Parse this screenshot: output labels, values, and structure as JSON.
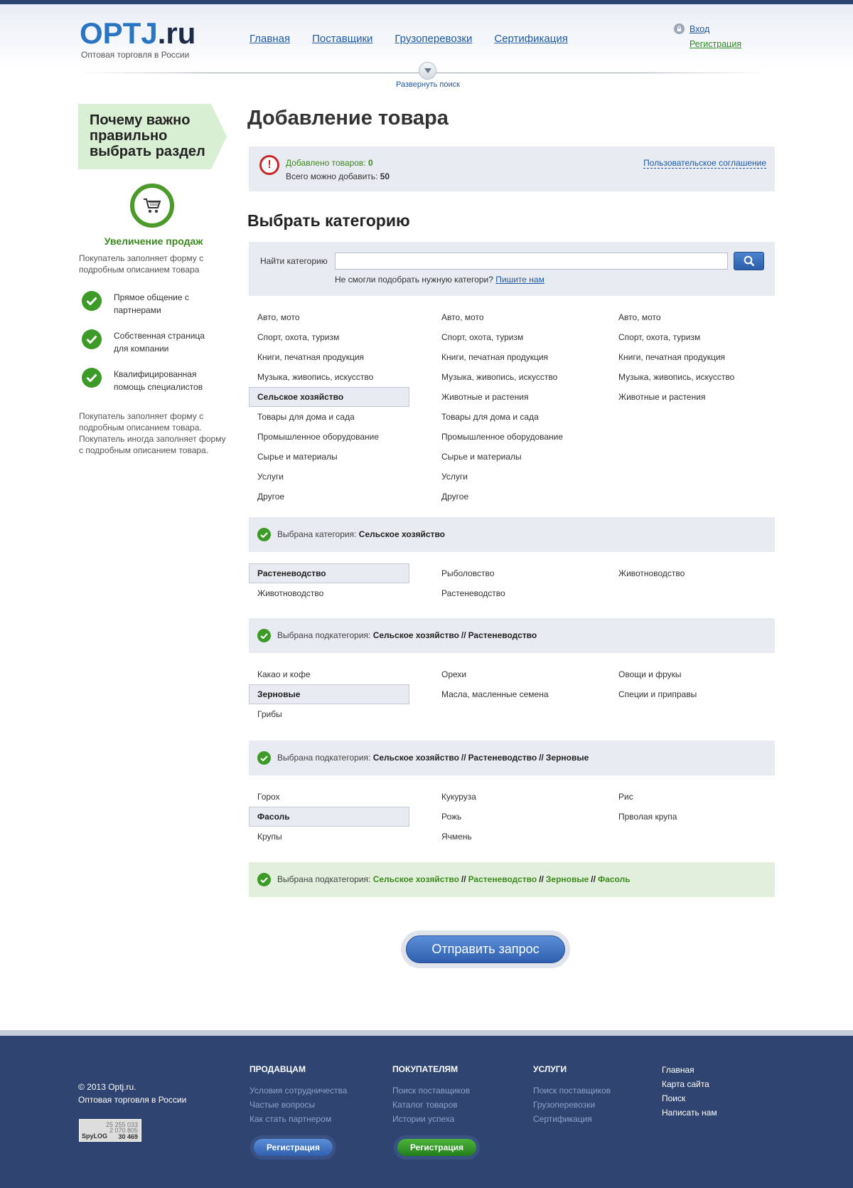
{
  "header": {
    "logo_main": "OPTJ",
    "logo_tld": ".ru",
    "logo_sub": "Оптовая торговля в России",
    "nav": [
      "Главная",
      "Поставщики",
      "Грузоперевозки",
      "Сертификация"
    ],
    "login": "Вход",
    "register": "Регистрация",
    "expand_search": "Развернуть поиск"
  },
  "sidebar": {
    "why_title": "Почему важно правильно выбрать раздел",
    "sales_title": "Увеличение продаж",
    "sales_desc": "Покупатель заполняет форму с подробным описанием товара",
    "features": [
      "Прямое общение с партнерами",
      "Собственная страница для компании",
      "Квалифицированная помощь специалистов"
    ],
    "footer_text": "Покупатель заполняет форму с подробным описанием товара. Покупатель иногда заполняет форму с подробным описанием товара."
  },
  "main": {
    "title": "Добавление товара",
    "info": {
      "added_label": "Добавлено товаров:",
      "added_value": "0",
      "total_label": "Всего можно добавить:",
      "total_value": "50",
      "agreement": "Пользовательское соглашение"
    },
    "choose_title": "Выбрать категорию",
    "search": {
      "label": "Найти категорию",
      "value": "",
      "placeholder": "",
      "hint": "Не смогли подобрать нужную категори?",
      "hint_link": "Пишите нам"
    },
    "categories": {
      "col1": [
        "Авто, мото",
        "Спорт, охота, туризм",
        "Книги, печатная продукция",
        "Музыка, живопись, искусство",
        "Сельское хозяйство",
        "Товары для дома и сада",
        "Промышленное оборудование",
        "Сырье и материалы",
        "Услуги",
        "Другое"
      ],
      "col2": [
        "Авто, мото",
        "Спорт, охота, туризм",
        "Книги, печатная продукция",
        "Музыка, живопись, искусство",
        "Животные и растения",
        "Товары для дома и сада",
        "Промышленное оборудование",
        "Сырье и материалы",
        "Услуги",
        "Другое"
      ],
      "col3": [
        "Авто, мото",
        "Спорт, охота, туризм",
        "Книги, печатная продукция",
        "Музыка, живопись, искусство",
        "Животные и растения"
      ]
    },
    "chosen1": {
      "label": "Выбрана категория:",
      "path": [
        "Сельское хозяйство"
      ]
    },
    "sub1": {
      "col1": [
        "Растеневодство",
        "Животноводство"
      ],
      "col2": [
        "Рыболовство",
        "Растеневодство"
      ],
      "col3": [
        "Животноводство"
      ]
    },
    "chosen2": {
      "label": "Выбрана подкатегория:",
      "path": [
        "Сельское хозяйство",
        "Растеневодство"
      ]
    },
    "sub2": {
      "col1": [
        "Какао и кофе",
        "Зерновые",
        "Грибы"
      ],
      "col2": [
        "Орехи",
        "Масла, масленные семена"
      ],
      "col3": [
        "Овощи и фрукы",
        "Специи и приправы"
      ]
    },
    "chosen3": {
      "label": "Выбрана подкатегория:",
      "path": [
        "Сельское хозяйство",
        "Растеневодство",
        "Зерновые"
      ]
    },
    "sub3": {
      "col1": [
        "Горох",
        "Фасоль",
        "Крупы"
      ],
      "col2": [
        "Кукуруза",
        "Рожь",
        "Ячмень"
      ],
      "col3": [
        "Рис",
        "Прволая крупа"
      ]
    },
    "chosen4": {
      "label": "Выбрана подкатегория:",
      "path": [
        "Сельское хозяйство",
        "Растеневодство",
        "Зерновые",
        "Фасоль"
      ]
    },
    "separator": "//",
    "submit": "Отправить запрос"
  },
  "footer": {
    "copyright_line1": "© 2013 Optj.ru.",
    "copyright_line2": "Оптовая торговля в России",
    "counter": {
      "brand": "SpyLOG",
      "v1": "25 255 033",
      "v2": "2 070 805",
      "v3": "30 469"
    },
    "sellers": {
      "title": "ПРОДАВЦАМ",
      "links": [
        "Условия сотрудничества",
        "Частые вопросы",
        "Как стать партнером"
      ],
      "button": "Регистрация"
    },
    "buyers": {
      "title": "ПОКУПАТЕЛЯМ",
      "links": [
        "Поиск поставщиков",
        "Каталог товаров",
        "Истории успеха"
      ],
      "button": "Регистрация"
    },
    "services": {
      "title": "УСЛУГИ",
      "links": [
        "Поиск поставщиков",
        "Грузоперевозки",
        "Сертификация"
      ]
    },
    "quick": [
      "Главная",
      "Карта сайта",
      "Поиск",
      "Написать нам"
    ]
  },
  "colors": {
    "brand_blue": "#2a74c4",
    "brand_dark": "#1d2b48",
    "accent_green": "#3c9a27",
    "footer_bg": "#2f4471",
    "panel_bg": "#e8ebf1"
  }
}
